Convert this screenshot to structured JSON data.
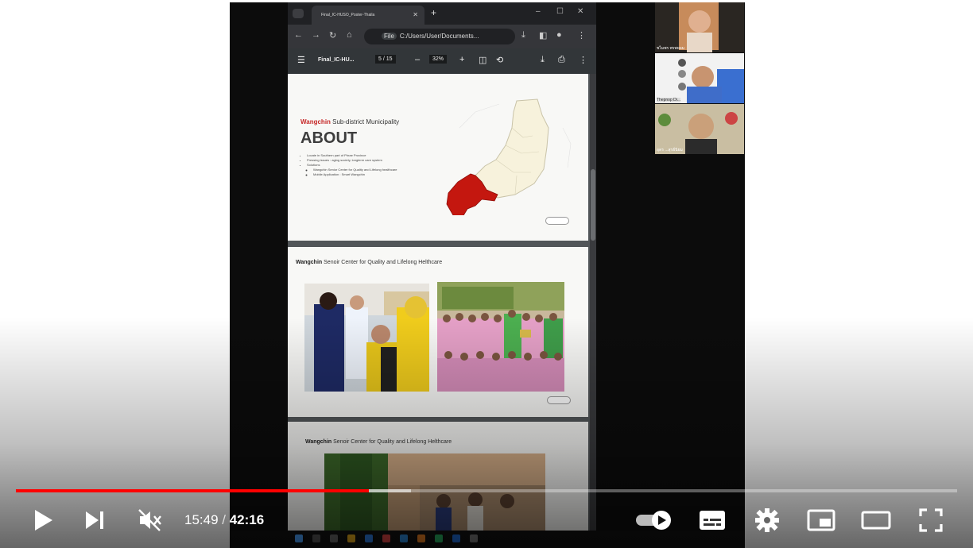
{
  "player": {
    "current_time": "15:49",
    "separator": " / ",
    "duration": "42:16",
    "progress_fraction": 0.375,
    "buffer_fraction": 0.42,
    "accent_color": "#ff0000"
  },
  "browser": {
    "tab_title": "Final_IC-HUSO_Poster-Thaila",
    "address": "C:/Users/User/Documents...",
    "address_prefix": "File",
    "pdf_title": "Final_IC-HU...",
    "page_current": "5",
    "page_total": "/ 15",
    "zoom": "32%"
  },
  "pdf": {
    "page1": {
      "subtitle_bold": "Wangchin",
      "subtitle_rest": " Sub-district Municipality",
      "heading": "ABOUT",
      "bullets": [
        "Locate in Southern part of Phrae Province",
        "Pressing issues : aging society, longterm care system",
        "Solutions"
      ],
      "sub_bullets": [
        "Wangchin Senior Center for Quality and Lifelong healthcare",
        "Mobile Application : Smart Wangchin"
      ]
    },
    "page2": {
      "title_bold": "Wangchin",
      "title_rest": " Senoir Center for Quality and Lifelong Helthcare"
    },
    "page3": {
      "title_bold": "Wangchin",
      "title_rest": " Senoir Center for Quality and Lifelong Helthcare"
    }
  },
  "participants": [
    {
      "label": "ชไมพร พรพยอม"
    },
    {
      "label": "Thepnop Di..."
    },
    {
      "label": "อุดร ...สุรย์นิยม"
    }
  ],
  "icons": [
    "play-icon",
    "next-icon",
    "mute-icon",
    "autoplay-toggle-icon",
    "subtitles-icon",
    "settings-icon",
    "miniplayer-icon",
    "theater-icon",
    "fullscreen-icon"
  ]
}
